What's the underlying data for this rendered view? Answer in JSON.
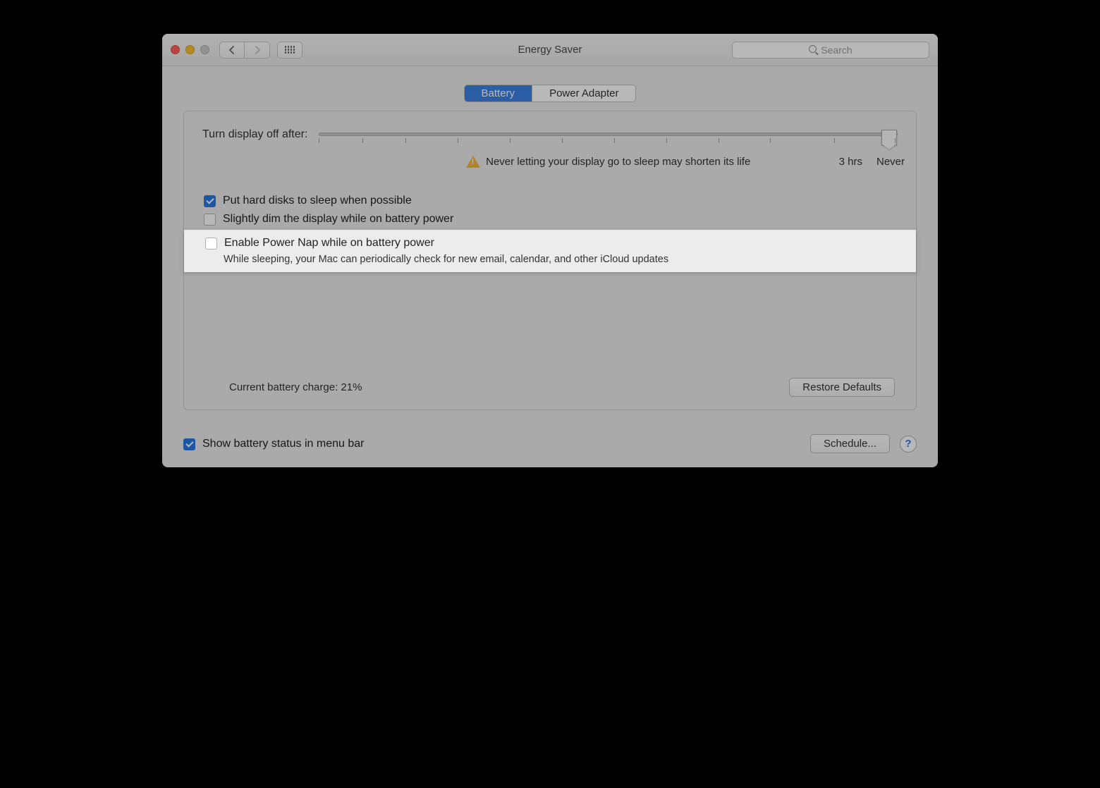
{
  "window": {
    "title": "Energy Saver"
  },
  "search": {
    "placeholder": "Search"
  },
  "tabs": {
    "battery": "Battery",
    "adapter": "Power Adapter"
  },
  "slider": {
    "label": "Turn display off after:",
    "warning": "Never letting your display go to sleep may shorten its life",
    "label_3hrs": "3 hrs",
    "label_never": "Never"
  },
  "options": {
    "hard_disks": "Put hard disks to sleep when possible",
    "dim_display": "Slightly dim the display while on battery power",
    "power_nap": "Enable Power Nap while on battery power",
    "power_nap_desc": "While sleeping, your Mac can periodically check for new email, calendar, and other iCloud updates"
  },
  "status": {
    "battery_charge": "Current battery charge: 21%"
  },
  "buttons": {
    "restore": "Restore Defaults",
    "schedule": "Schedule..."
  },
  "footer": {
    "show_status": "Show battery status in menu bar"
  }
}
